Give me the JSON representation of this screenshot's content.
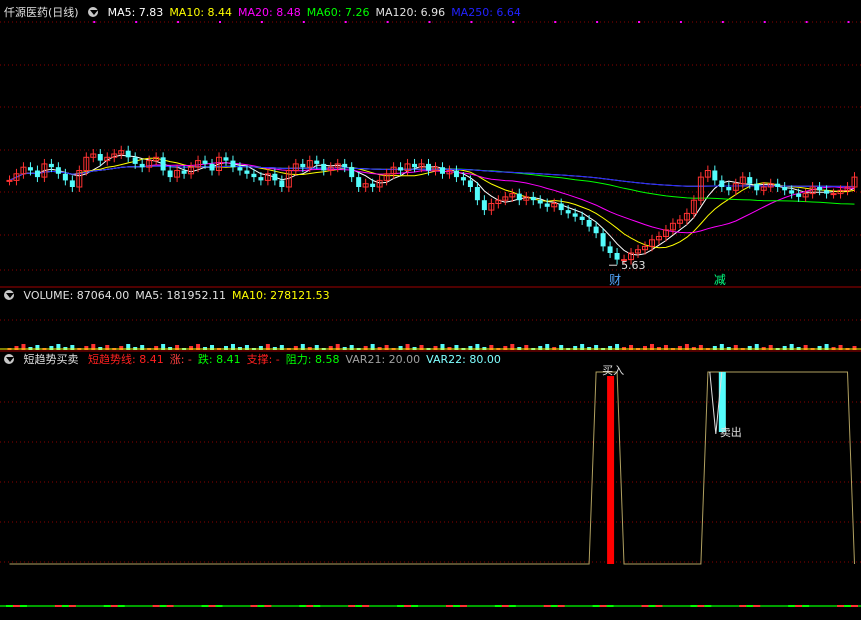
{
  "price_header": {
    "title": "仟源医药(日线)",
    "items": [
      {
        "label": "MA5:",
        "value": "7.83",
        "color": "#ffffff"
      },
      {
        "label": "MA10:",
        "value": "8.44",
        "color": "#ffff00"
      },
      {
        "label": "MA20:",
        "value": "8.48",
        "color": "#ff00ff"
      },
      {
        "label": "MA60:",
        "value": "7.26",
        "color": "#00ff00"
      },
      {
        "label": "MA120:",
        "value": "6.96",
        "color": "#e0e0e0"
      },
      {
        "label": "MA250:",
        "value": "6.64",
        "color": "#2222ff"
      }
    ]
  },
  "volume_header": {
    "items": [
      {
        "label": "VOLUME:",
        "value": "87064.00",
        "color": "#e0e0e0"
      },
      {
        "label": "MA5:",
        "value": "181952.11",
        "color": "#e0e0e0"
      },
      {
        "label": "MA10:",
        "value": "278121.53",
        "color": "#ffff00"
      }
    ]
  },
  "indicator_header": {
    "title": "短趋势买卖",
    "items": [
      {
        "label": "短趋势线:",
        "value": "8.41",
        "color": "#ff2020"
      },
      {
        "label": "涨:",
        "value": "-",
        "color": "#ff4040"
      },
      {
        "label": "跌:",
        "value": "8.41",
        "color": "#00ff00"
      },
      {
        "label": "支撑:",
        "value": "-",
        "color": "#ff2020"
      },
      {
        "label": "阻力:",
        "value": "8.58",
        "color": "#00ff00"
      },
      {
        "label": "VAR21:",
        "value": "20.00",
        "color": "#a0a0a0"
      },
      {
        "label": "VAR22:",
        "value": "80.00",
        "color": "#80ffff"
      }
    ]
  },
  "annotations": {
    "low_price": "5.63",
    "cai": "财",
    "jian": "减",
    "sell": "卖出",
    "buy": "买入"
  },
  "colors": {
    "up": "#ff3232",
    "down": "#54fcfc",
    "grid": "#8b0000",
    "ma5": "#ffffff",
    "ma10": "#ffff00",
    "ma20": "#ff00ff",
    "ma60": "#00ff00",
    "ma120": "#e0e0e0",
    "ma250": "#2222ff",
    "trend_line": "#b0a060"
  },
  "chart_data": [
    {
      "type": "candlestick",
      "title": "仟源医药(日线)",
      "lowest_marked": 5.63,
      "ma_latest": {
        "MA5": 7.83,
        "MA10": 8.44,
        "MA20": 8.48,
        "MA60": 7.26,
        "MA120": 6.96,
        "MA250": 6.64
      },
      "close": [
        8.2,
        8.4,
        8.6,
        8.5,
        8.3,
        8.7,
        8.6,
        8.4,
        8.2,
        8.0,
        8.5,
        8.9,
        9.0,
        8.8,
        8.9,
        9.0,
        9.1,
        8.9,
        8.7,
        8.6,
        8.8,
        8.9,
        8.5,
        8.3,
        8.5,
        8.4,
        8.6,
        8.8,
        8.7,
        8.5,
        8.9,
        8.8,
        8.6,
        8.5,
        8.4,
        8.3,
        8.2,
        8.4,
        8.2,
        8.0,
        8.5,
        8.7,
        8.6,
        8.8,
        8.7,
        8.5,
        8.6,
        8.7,
        8.6,
        8.3,
        8.0,
        8.1,
        8.0,
        8.2,
        8.4,
        8.6,
        8.5,
        8.7,
        8.6,
        8.7,
        8.5,
        8.6,
        8.4,
        8.5,
        8.3,
        8.2,
        8.0,
        7.6,
        7.3,
        7.5,
        7.6,
        7.7,
        7.8,
        7.6,
        7.7,
        7.6,
        7.5,
        7.4,
        7.5,
        7.3,
        7.2,
        7.1,
        7.0,
        6.8,
        6.6,
        6.2,
        6.0,
        5.8,
        5.8,
        6.0,
        6.1,
        6.2,
        6.4,
        6.5,
        6.7,
        6.9,
        7.0,
        7.2,
        7.6,
        8.3,
        8.5,
        8.2,
        8.0,
        7.9,
        8.1,
        8.3,
        8.1,
        7.9,
        8.0,
        8.1,
        8.0,
        7.9,
        7.8,
        7.7,
        7.8,
        8.0,
        7.9,
        7.8,
        7.8,
        7.9,
        8.0,
        8.3
      ],
      "y_range": [
        5.0,
        13.0
      ]
    },
    {
      "type": "bar",
      "title": "VOLUME",
      "latest": {
        "VOLUME": 87064.0,
        "MA5": 181952.11,
        "MA10": 278121.53
      }
    },
    {
      "type": "line",
      "title": "短趋势买卖",
      "series": [
        {
          "name": "VAR21",
          "latest": 20.0
        },
        {
          "name": "VAR22",
          "latest": 80.0
        }
      ],
      "ylim": [
        0,
        100
      ],
      "trend": [
        0,
        0,
        0,
        0,
        0,
        0,
        0,
        0,
        0,
        0,
        0,
        0,
        0,
        0,
        0,
        0,
        0,
        0,
        0,
        0,
        0,
        0,
        0,
        0,
        0,
        0,
        0,
        0,
        0,
        0,
        0,
        0,
        0,
        0,
        0,
        0,
        0,
        0,
        0,
        0,
        0,
        0,
        0,
        0,
        0,
        0,
        0,
        0,
        0,
        0,
        0,
        0,
        0,
        0,
        0,
        0,
        0,
        0,
        0,
        0,
        0,
        0,
        0,
        0,
        0,
        0,
        0,
        0,
        0,
        0,
        0,
        0,
        0,
        0,
        0,
        0,
        0,
        0,
        0,
        0,
        0,
        0,
        0,
        0,
        100,
        100,
        100,
        100,
        0,
        0,
        0,
        0,
        0,
        0,
        0,
        0,
        0,
        0,
        0,
        0,
        100,
        100,
        100,
        100,
        100,
        100,
        100,
        100,
        100,
        100,
        100,
        100,
        100,
        100,
        100,
        100,
        100,
        100,
        100,
        100,
        100,
        0
      ],
      "buy_index": 86,
      "sell_index": 102
    }
  ]
}
